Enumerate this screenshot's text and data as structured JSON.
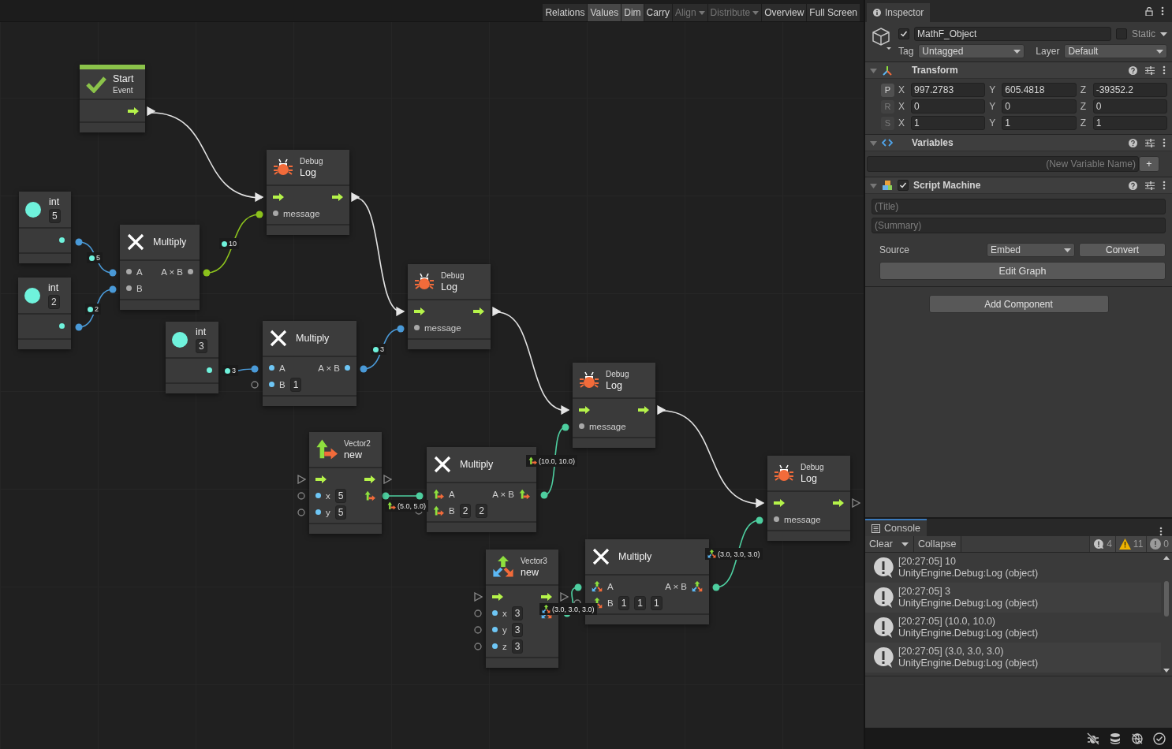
{
  "toolbar": [
    {
      "label": "Relations",
      "kind": "toggle",
      "selected": false,
      "disabled": false
    },
    {
      "label": "Values",
      "kind": "toggle",
      "selected": true,
      "disabled": false
    },
    {
      "label": "Dim",
      "kind": "toggle",
      "selected": true,
      "disabled": false
    },
    {
      "label": "Carry",
      "kind": "toggle",
      "selected": false,
      "disabled": false
    },
    {
      "label": "Align",
      "kind": "dropdown",
      "selected": false,
      "disabled": true
    },
    {
      "label": "Distribute",
      "kind": "dropdown",
      "selected": false,
      "disabled": true
    },
    {
      "label": "Overview",
      "kind": "toggle",
      "selected": false,
      "disabled": false
    },
    {
      "label": "Full Screen",
      "kind": "toggle",
      "selected": false,
      "disabled": false
    }
  ],
  "graph": {
    "nodes": [
      {
        "kind": "event",
        "title": "Start",
        "subtitle": "Event"
      },
      {
        "kind": "literal",
        "type": "int",
        "value": "5"
      },
      {
        "kind": "literal",
        "type": "int",
        "value": "2"
      },
      {
        "kind": "multiply",
        "title": "Multiply",
        "inputs": [
          {
            "label": "A",
            "kind": "generic"
          },
          {
            "label": "B",
            "kind": "generic"
          }
        ],
        "output": {
          "label": "A × B",
          "kind": "generic"
        }
      },
      {
        "kind": "debug",
        "category": "Debug",
        "title": "Log",
        "input": "message",
        "flow_out_connected": true
      },
      {
        "kind": "literal",
        "type": "int",
        "value": "3"
      },
      {
        "kind": "multiply",
        "title": "Multiply",
        "inputs": [
          {
            "label": "A",
            "kind": "int"
          },
          {
            "label": "B",
            "kind": "int",
            "defaults": [
              "1"
            ]
          }
        ],
        "output": {
          "label": "A × B",
          "kind": "int"
        }
      },
      {
        "kind": "debug",
        "category": "Debug",
        "title": "Log",
        "input": "message",
        "flow_out_connected": true
      },
      {
        "kind": "vector",
        "category": "Vector2",
        "title": "new",
        "params": [
          {
            "label": "x",
            "value": "5"
          },
          {
            "label": "y",
            "value": "5"
          }
        ]
      },
      {
        "kind": "multiply",
        "title": "Multiply",
        "inputs": [
          {
            "label": "A",
            "kind": "vector2"
          },
          {
            "label": "B",
            "kind": "vector2",
            "defaults": [
              "2",
              "2"
            ]
          }
        ],
        "output": {
          "label": "A × B",
          "kind": "vector2"
        }
      },
      {
        "kind": "debug",
        "category": "Debug",
        "title": "Log",
        "input": "message",
        "flow_out_connected": true
      },
      {
        "kind": "debug",
        "category": "Debug",
        "title": "Log",
        "input": "message",
        "flow_out_connected": false
      },
      {
        "kind": "vector",
        "category": "Vector3",
        "title": "new",
        "params": [
          {
            "label": "x",
            "value": "3"
          },
          {
            "label": "y",
            "value": "3"
          },
          {
            "label": "z",
            "value": "3"
          }
        ]
      },
      {
        "kind": "multiply",
        "title": "Multiply",
        "inputs": [
          {
            "label": "A",
            "kind": "vector3"
          },
          {
            "label": "B",
            "kind": "vector3",
            "defaults": [
              "1",
              "1",
              "1"
            ]
          }
        ],
        "output": {
          "label": "A × B",
          "kind": "vector3"
        }
      }
    ],
    "connections": [
      {
        "kind": "flow"
      },
      {
        "kind": "flow"
      },
      {
        "kind": "flow"
      },
      {
        "kind": "flow"
      },
      {
        "kind": "int",
        "value": "5"
      },
      {
        "kind": "int",
        "value": "2"
      },
      {
        "kind": "object",
        "value": "10"
      },
      {
        "kind": "int",
        "value": "3"
      },
      {
        "kind": "int",
        "value": "3"
      },
      {
        "kind": "vector2",
        "value": "(5.0, 5.0)"
      },
      {
        "kind": "vector2",
        "value": "(10.0, 10.0)"
      },
      {
        "kind": "vector3",
        "value": "(3.0, 3.0, 3.0)"
      },
      {
        "kind": "vector3",
        "value": "(3.0, 3.0, 3.0)"
      }
    ]
  },
  "inspector": {
    "tab": "Inspector",
    "object": {
      "enabled": true,
      "name": "MathF_Object",
      "static": false,
      "static_label": "Static",
      "tag_label": "Tag",
      "tag": "Untagged",
      "layer_label": "Layer",
      "layer": "Default"
    },
    "components": [
      {
        "kind": "transform",
        "title": "Transform",
        "expanded": true,
        "rows": [
          {
            "key": "P",
            "active": true,
            "fields": [
              {
                "axis": "X",
                "value": "997.2783"
              },
              {
                "axis": "Y",
                "value": "605.4818"
              },
              {
                "axis": "Z",
                "value": "-39352.2"
              }
            ]
          },
          {
            "key": "R",
            "active": false,
            "fields": [
              {
                "axis": "X",
                "value": "0"
              },
              {
                "axis": "Y",
                "value": "0"
              },
              {
                "axis": "Z",
                "value": "0"
              }
            ]
          },
          {
            "key": "S",
            "active": false,
            "fields": [
              {
                "axis": "X",
                "value": "1"
              },
              {
                "axis": "Y",
                "value": "1"
              },
              {
                "axis": "Z",
                "value": "1"
              }
            ]
          }
        ]
      },
      {
        "kind": "variables",
        "title": "Variables",
        "expanded": true,
        "placeholder": "(New Variable Name)",
        "add": "+"
      },
      {
        "kind": "script_machine",
        "title": "Script Machine",
        "enabled": true,
        "expanded": true,
        "title_placeholder": "(Title)",
        "summary_placeholder": "(Summary)",
        "source_label": "Source",
        "source": "Embed",
        "convert": "Convert",
        "edit": "Edit Graph"
      }
    ],
    "add_component": "Add Component"
  },
  "console": {
    "tab": "Console",
    "clear": "Clear",
    "collapse": "Collapse",
    "counts": [
      {
        "kind": "info",
        "value": "4"
      },
      {
        "kind": "warning",
        "value": "11"
      },
      {
        "kind": "error",
        "value": "0"
      }
    ],
    "messages": [
      {
        "line1": "[20:27:05] 10",
        "line2": "UnityEngine.Debug:Log (object)"
      },
      {
        "line1": "[20:27:05] 3",
        "line2": "UnityEngine.Debug:Log (object)"
      },
      {
        "line1": "[20:27:05] (10.0, 10.0)",
        "line2": "UnityEngine.Debug:Log (object)"
      },
      {
        "line1": "[20:27:05] (3.0, 3.0, 3.0)",
        "line2": "UnityEngine.Debug:Log (object)"
      }
    ]
  }
}
